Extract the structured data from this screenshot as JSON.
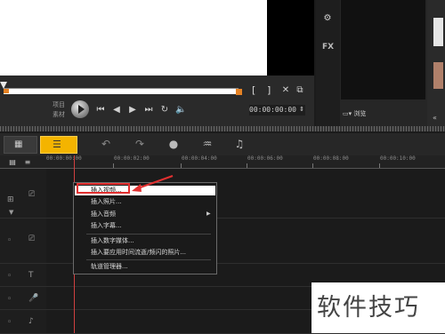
{
  "player": {
    "mode_project": "项目",
    "mode_clip": "素材",
    "timecode": "00:00:00:00",
    "bracket_in": "[",
    "bracket_out": "]"
  },
  "library": {
    "fx_label": "FX",
    "browse_label": "浏览"
  },
  "ruler": {
    "ticks": [
      "00:00:00:00",
      "00:00:02:00",
      "00:00:04:00",
      "00:00:06:00",
      "00:00:08:00",
      "00:00:10:00"
    ]
  },
  "context_menu": {
    "items": [
      "插入视频...",
      "插入照片...",
      "插入音频",
      "插入字幕...",
      "插入数字媒体...",
      "插入要应用时间流逝/频闪的照片...",
      "轨道管理器..."
    ]
  },
  "watermark": {
    "text": "软件技巧"
  },
  "colors": {
    "accent": "#f4b400",
    "scrub_marker": "#e58224",
    "highlight": "#e23030"
  }
}
